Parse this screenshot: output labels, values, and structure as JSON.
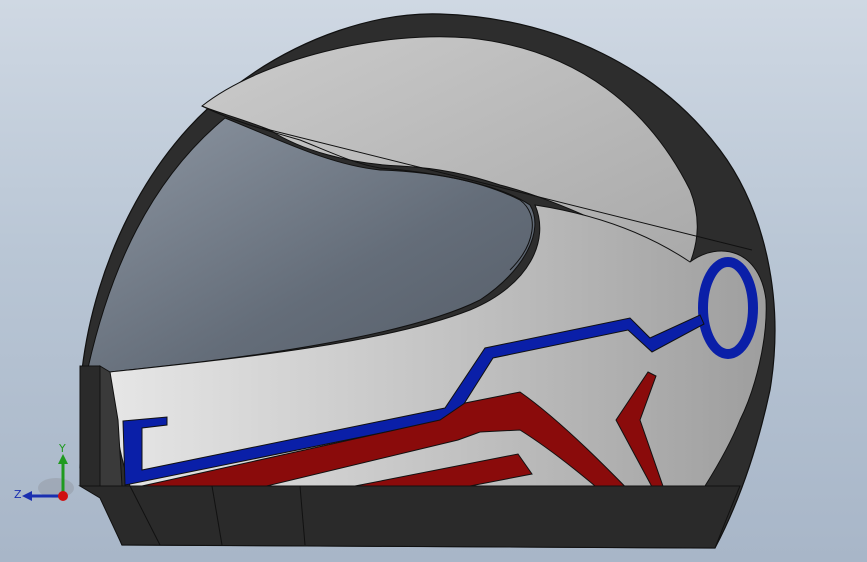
{
  "model": {
    "name": "helmet-model",
    "colors": {
      "background_top": "#cfd8e3",
      "background_bottom": "#a8b6c8",
      "shell": "#2b2b2b",
      "shell_highlight": "#3a3a3a",
      "visor": "#6b7480",
      "visor_light": "#8a93a0",
      "panel": "#b8b8b8",
      "panel_light": "#d0d0d0",
      "stripe_blue": "#0a1fa8",
      "stripe_red": "#8a0b0b",
      "outline": "#111111"
    }
  },
  "triad": {
    "y_label": "Y",
    "z_label": "Z",
    "y_color": "#1f9a1f",
    "z_color": "#1a2fb0",
    "origin_color": "#d01010"
  }
}
